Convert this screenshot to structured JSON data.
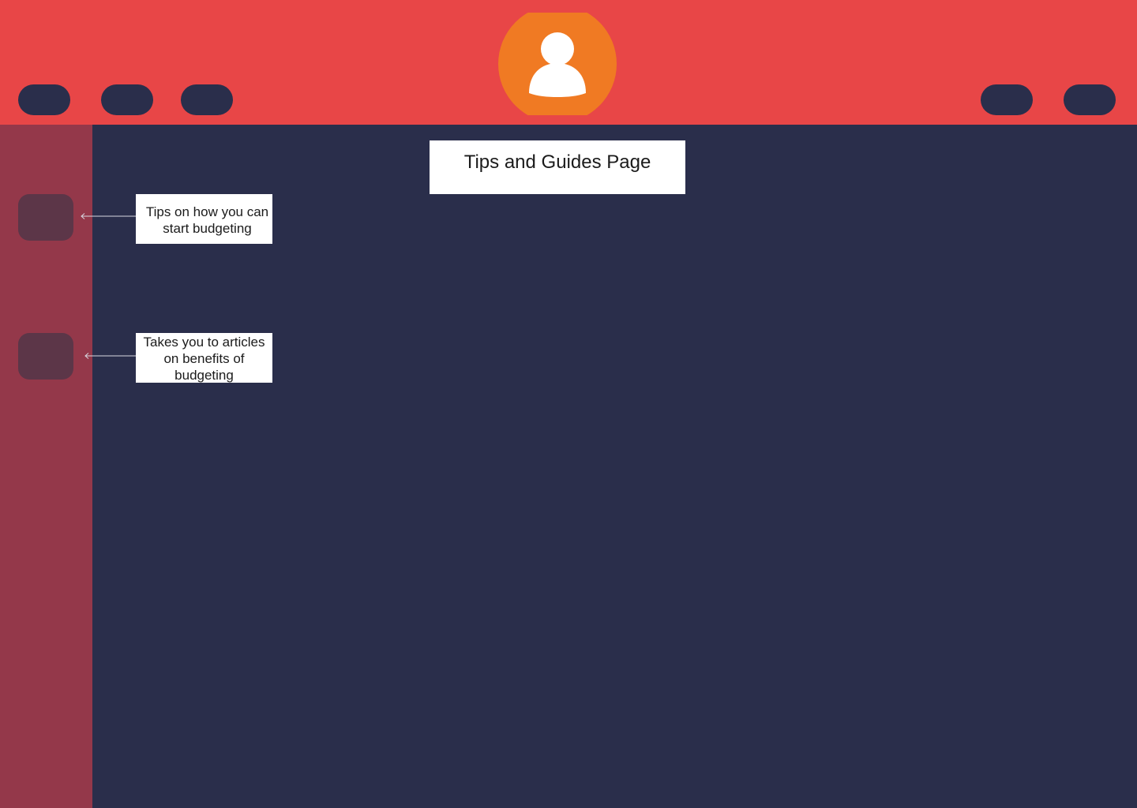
{
  "header": {
    "left_nav": [
      "",
      "",
      ""
    ],
    "right_nav": [
      "",
      ""
    ],
    "avatar_icon": "user-profile-icon"
  },
  "sidebar": {
    "items": [
      {
        "label": ""
      },
      {
        "label": ""
      }
    ]
  },
  "main": {
    "title": "Tips and Guides Page"
  },
  "annotations": {
    "tips_note": "Tips on how you can start budgeting",
    "articles_note": "Takes you to articles on benefits of budgeting"
  },
  "colors": {
    "header": "#e84647",
    "sidebar": "#94384a",
    "main_bg": "#2a2e4b",
    "avatar_bg": "#f07a23",
    "sidebar_button": "#5c3648"
  }
}
